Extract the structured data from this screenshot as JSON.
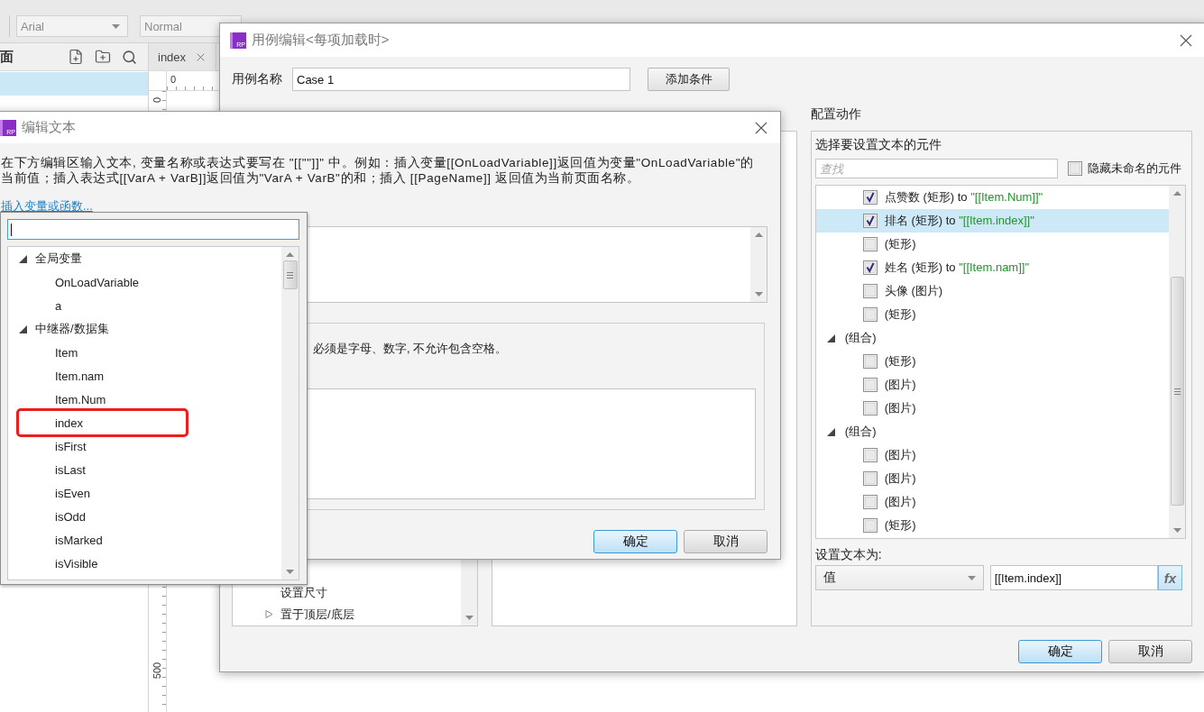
{
  "toolbar": {
    "font_family": "Arial",
    "font_weight": "Normal"
  },
  "pages_panel": {
    "title": "面",
    "rows": [
      {
        "selected": true
      }
    ]
  },
  "canvas": {
    "tab": {
      "label": "index"
    },
    "h_ruler_labels": [
      "0"
    ],
    "v_ruler_labels": [
      "0",
      "500"
    ]
  },
  "case_editor": {
    "logo": "RP",
    "title": "用例编辑<每项加载时>",
    "case_name_label": "用例名称",
    "case_name": "Case 1",
    "add_condition_button": "添加条件",
    "actions": [
      {
        "kind": "action",
        "label": "设置尺寸"
      },
      {
        "kind": "folder",
        "label": "置于顶层/底层",
        "expanded": false
      }
    ],
    "configure": {
      "heading": "配置动作",
      "prompt": "选择要设置文本的元件",
      "search_placeholder": "查找",
      "hide_unnamed": {
        "label": "隐藏未命名的元件",
        "checked": false
      },
      "widgets": [
        {
          "kind": "widget",
          "label": "点赞数 (矩形) to",
          "binding": "\"[[Item.Num]]\"",
          "checked": true,
          "selected": false
        },
        {
          "kind": "widget",
          "label": "排名 (矩形) to",
          "binding": "\"[[Item.index]]\"",
          "checked": true,
          "selected": true
        },
        {
          "kind": "widget",
          "label": "(矩形)",
          "checked": false,
          "selected": false
        },
        {
          "kind": "widget",
          "label": "姓名 (矩形) to",
          "binding": "\"[[Item.nam]]\"",
          "checked": true,
          "selected": false
        },
        {
          "kind": "widget",
          "label": "头像 (图片)",
          "checked": false,
          "selected": false
        },
        {
          "kind": "widget",
          "label": "(矩形)",
          "checked": false,
          "selected": false
        },
        {
          "kind": "group",
          "label": "(组合)",
          "expanded": true,
          "selected": false,
          "children": [
            {
              "kind": "widget",
              "label": "(矩形)",
              "checked": false,
              "selected": false
            },
            {
              "kind": "widget",
              "label": "(图片)",
              "checked": false,
              "selected": false
            },
            {
              "kind": "widget",
              "label": "(图片)",
              "checked": false,
              "selected": false
            }
          ]
        },
        {
          "kind": "group",
          "label": "(组合)",
          "expanded": true,
          "selected": false,
          "children": [
            {
              "kind": "widget",
              "label": "(图片)",
              "checked": false,
              "selected": false
            },
            {
              "kind": "widget",
              "label": "(图片)",
              "checked": false,
              "selected": false
            },
            {
              "kind": "widget",
              "label": "(图片)",
              "checked": false,
              "selected": false
            },
            {
              "kind": "widget",
              "label": "(矩形)",
              "checked": false,
              "selected": false
            }
          ]
        }
      ],
      "set_text_label": "设置文本为:",
      "value_type": "值",
      "value": "[[Item.index]]",
      "fx_button": "fx"
    },
    "buttons": [
      {
        "label": "确定",
        "primary": true
      },
      {
        "label": "取消",
        "primary": false
      }
    ]
  },
  "edit_text_dialog": {
    "logo": "RP",
    "title": "编辑文本",
    "instructions": "在下方编辑区输入文本, 变量名称或表达式要写在 \"[[\"\"]]\" 中。例如：插入变量[[OnLoadVariable]]返回值为变量\"OnLoadVariable\"的当前值；插入表达式[[VarA + VarB]]返回值为\"VarA + VarB\"的和；插入 [[PageName]] 返回值为当前页面名称。",
    "insert_link": "插入变量或函数...",
    "note": "必须是字母、数字, 不允许包含空格。",
    "buttons": [
      {
        "label": "确定",
        "primary": true
      },
      {
        "label": "取消",
        "primary": false
      }
    ]
  },
  "variable_picker": {
    "tree": [
      {
        "label": "全局变量",
        "expanded": true,
        "children": [
          {
            "label": "OnLoadVariable",
            "highlighted": false
          },
          {
            "label": "a",
            "highlighted": false
          }
        ]
      },
      {
        "label": "中继器/数据集",
        "expanded": true,
        "children": [
          {
            "label": "Item",
            "highlighted": false
          },
          {
            "label": "Item.nam",
            "highlighted": false
          },
          {
            "label": "Item.Num",
            "highlighted": false
          },
          {
            "label": "index",
            "highlighted": true
          },
          {
            "label": "isFirst",
            "highlighted": false
          },
          {
            "label": "isLast",
            "highlighted": false
          },
          {
            "label": "isEven",
            "highlighted": false
          },
          {
            "label": "isOdd",
            "highlighted": false
          },
          {
            "label": "isMarked",
            "highlighted": false
          },
          {
            "label": "isVisible",
            "highlighted": false
          }
        ]
      }
    ]
  }
}
